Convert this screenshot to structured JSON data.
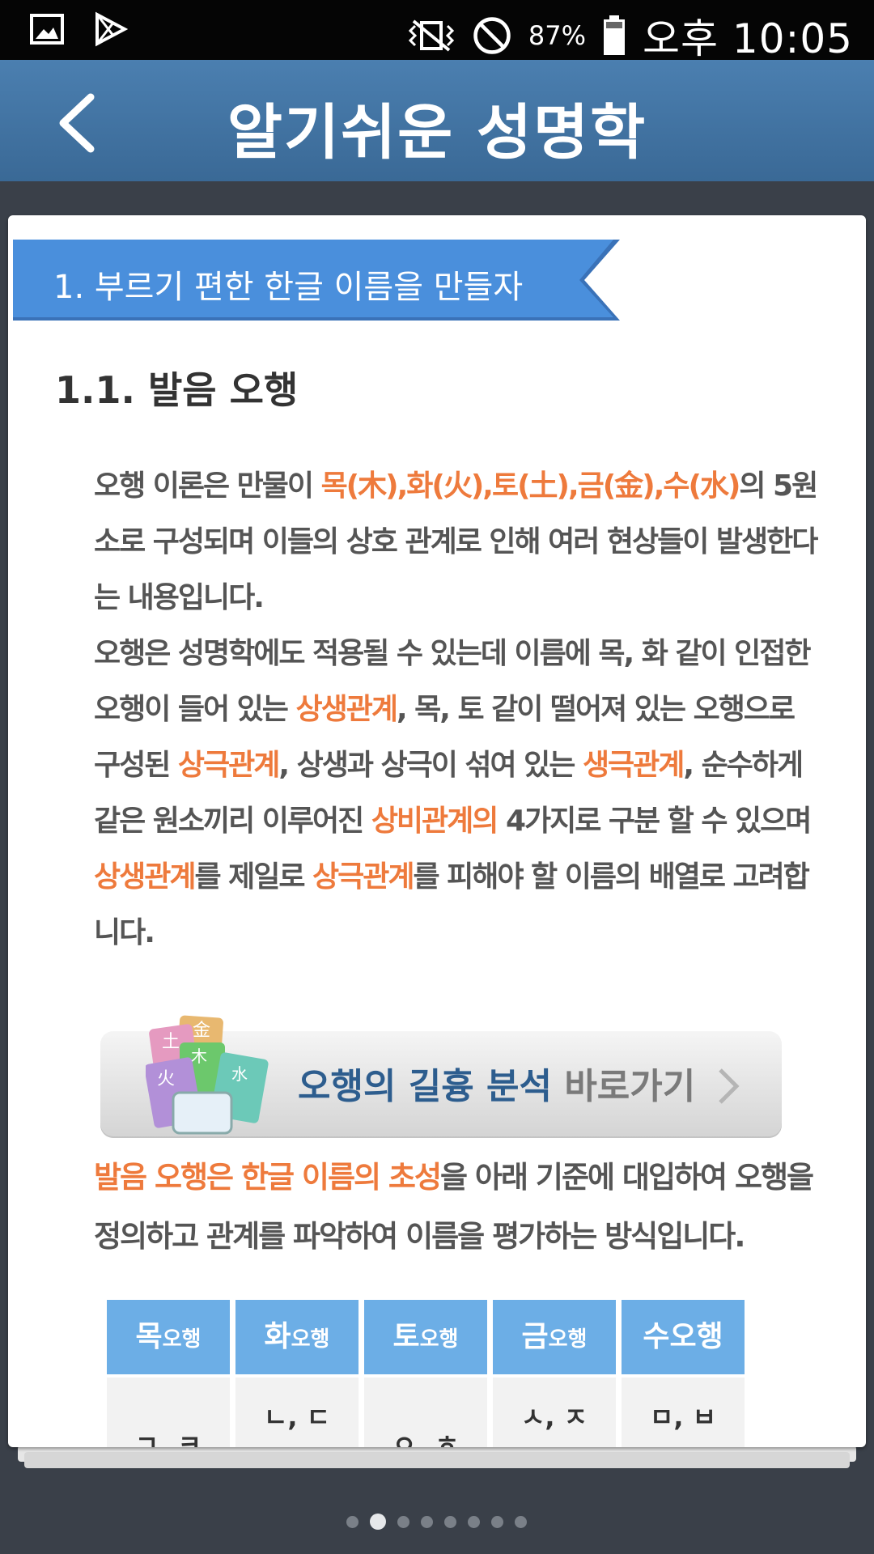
{
  "status_bar": {
    "battery": "87%",
    "time": "오후 10:05",
    "icons": [
      "gallery-icon",
      "play-store-icon",
      "vibrate-icon",
      "do-not-disturb-icon",
      "battery-icon"
    ]
  },
  "app_bar": {
    "title": "알기쉬운 성명학",
    "back_icon": "chevron-left-icon"
  },
  "section": {
    "ribbon": "1. 부르기 편한 한글 이름을 만들자",
    "subtitle": "1.1. 발음 오행"
  },
  "paragraph1": {
    "s1": "오행 이론은 만물이 ",
    "h1": "목(木),화(火),토(土),금(金),수(水)",
    "s2": "의 5원소로 구성되며 이들의 상호 관계로 인해 여러 현상들이 발생한다는 내용입니다.",
    "s3": "오행은 성명학에도 적용될 수 있는데 이름에 목, 화 같이 인접한 오행이 들어 있는 ",
    "h2": "상생관계",
    "s4": ", 목, 토 같이 떨어져 있는 오행으로 구성된 ",
    "h3": "상극관계",
    "s5": ", 상생과 상극이 섞여 있는 ",
    "h4": "생극관계",
    "s6": ", 순수하게 같은 원소끼리 이루어진 ",
    "h5": "상비관계의",
    "s7": " 4가지로 구분 할 수 있으며 ",
    "h6": "상생관계",
    "s8": "를 제일로 ",
    "h7": "상극관계",
    "s9": "를 피해야 할 이름의 배열로 고려합니다."
  },
  "banner": {
    "blue_text": "오행의 길흉 분석",
    "gray_text": " 바로가기",
    "arrow_icon": "chevron-right-icon",
    "icon_labels": [
      "土",
      "金",
      "木",
      "火",
      "水"
    ]
  },
  "paragraph2": {
    "h1": "발음 오행은 한글 이름의 초성",
    "s1": "을 아래 기준에 대입하여 오행을 정의하고 관계를 파악하여 이름을 평가하는 방식입니다."
  },
  "table": {
    "headers": [
      {
        "main": "목",
        "sub": "오행"
      },
      {
        "main": "화",
        "sub": "오행"
      },
      {
        "main": "토",
        "sub": "오행"
      },
      {
        "main": "금",
        "sub": "오행"
      },
      {
        "main": "수",
        "sub": "오행"
      }
    ],
    "cells": [
      "ㄱ, ㅋ",
      "ㄴ, ㄷ",
      "ㅇ, ㅎ",
      "ㅅ, ㅈ",
      "ㅁ, ㅂ"
    ]
  },
  "pagination": {
    "total": 8,
    "active": 1
  },
  "colors": {
    "app_bar": "#4478a8",
    "ribbon": "#4a8fdc",
    "highlight": "#ee7a3c",
    "table_header": "#6caee6",
    "background": "#3a4049"
  }
}
